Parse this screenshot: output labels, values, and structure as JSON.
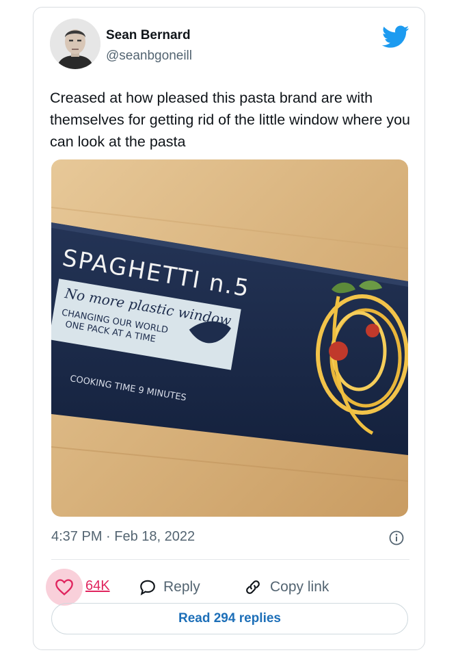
{
  "tweet": {
    "author_name": "Sean Bernard",
    "author_handle": "@seanbgoneill",
    "text": "Creased at how pleased this pasta brand are with themselves for getting rid of the little window where you can look at the pasta",
    "timestamp": "4:37 PM · Feb 18, 2022"
  },
  "photo": {
    "title": "SPAGHETTI n.5",
    "slogan": "No more plastic window",
    "line1": "CHANGING OUR WORLD",
    "line2": "ONE PACK AT A TIME",
    "cooking": "COOKING TIME 9 MINUTES"
  },
  "actions": {
    "like_count": "64K",
    "reply_label": "Reply",
    "copy_link_label": "Copy link",
    "read_replies_label": "Read 294 replies"
  },
  "icons": {
    "brand": "twitter-bird-icon",
    "like": "heart-icon",
    "reply": "speech-bubble-icon",
    "copy": "link-icon",
    "info": "info-icon"
  },
  "colors": {
    "brand_blue": "#1d9bf0",
    "like_red": "#e0245e",
    "muted": "#536471",
    "link_blue": "#1d6fb8"
  }
}
